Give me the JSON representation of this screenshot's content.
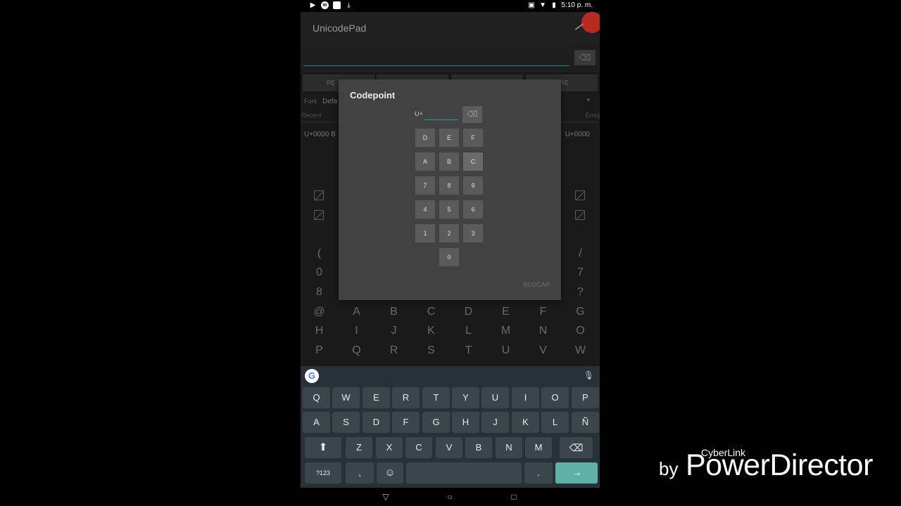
{
  "status": {
    "left_icons": [
      "play-icon",
      "messenger-icon",
      "file-icon",
      "download-icon"
    ],
    "right_icons": [
      "cast-icon",
      "wifi-icon",
      "battery-icon"
    ],
    "time": "5:10 p. m."
  },
  "app": {
    "title": "UnicodePad",
    "delete_glyph": "⌫",
    "tabs": [
      "PE",
      "",
      "",
      "ARE"
    ],
    "font_label": "Font",
    "font_value": "Defa",
    "recent_label": "Recent",
    "emoji_label": "Emoj",
    "code_left": "U+0000 B",
    "code_right": "U+0000",
    "grid_rows": [
      [
        "(",
        "",
        "",
        "",
        "",
        "",
        "",
        "/"
      ],
      [
        "0",
        "",
        "",
        "",
        "",
        "",
        "",
        "7"
      ],
      [
        "8",
        "",
        "",
        "",
        "",
        "",
        "",
        "?"
      ],
      [
        "@",
        "A",
        "B",
        "C",
        "D",
        "E",
        "F",
        "G"
      ],
      [
        "H",
        "I",
        "J",
        "K",
        "L",
        "M",
        "N",
        "O"
      ],
      [
        "P",
        "Q",
        "R",
        "S",
        "T",
        "U",
        "V",
        "W"
      ]
    ]
  },
  "dialog": {
    "title": "Codepoint",
    "prefix": "U+",
    "input_value": "",
    "delete_glyph": "⌫",
    "hex_keys": [
      [
        "D",
        "E",
        "F"
      ],
      [
        "A",
        "B",
        "C"
      ],
      [
        "7",
        "8",
        "9"
      ],
      [
        "4",
        "5",
        "6"
      ],
      [
        "1",
        "2",
        "3"
      ],
      [
        "0"
      ]
    ],
    "highlighted_key": "C",
    "search_label": "BUSCAR"
  },
  "keyboard": {
    "google_letter": "G",
    "mic_glyph": "🎤",
    "row1": [
      "Q",
      "W",
      "E",
      "R",
      "T",
      "Y",
      "U",
      "I",
      "O",
      "P"
    ],
    "row2": [
      "A",
      "S",
      "D",
      "F",
      "G",
      "H",
      "J",
      "K",
      "L",
      "Ñ"
    ],
    "row3": [
      "Z",
      "X",
      "C",
      "V",
      "B",
      "N",
      "M"
    ],
    "shift_glyph": "⬆",
    "backspace_glyph": "⌫",
    "symbols_label": "?123",
    "comma_label": ",",
    "emoji_glyph": "☺",
    "period_label": ".",
    "enter_glyph": "→"
  },
  "navbar": {
    "back": "▽",
    "home": "○",
    "recents": "□"
  },
  "watermark": {
    "small": "CyberLink",
    "by": "by",
    "brand": "PowerDirector"
  }
}
